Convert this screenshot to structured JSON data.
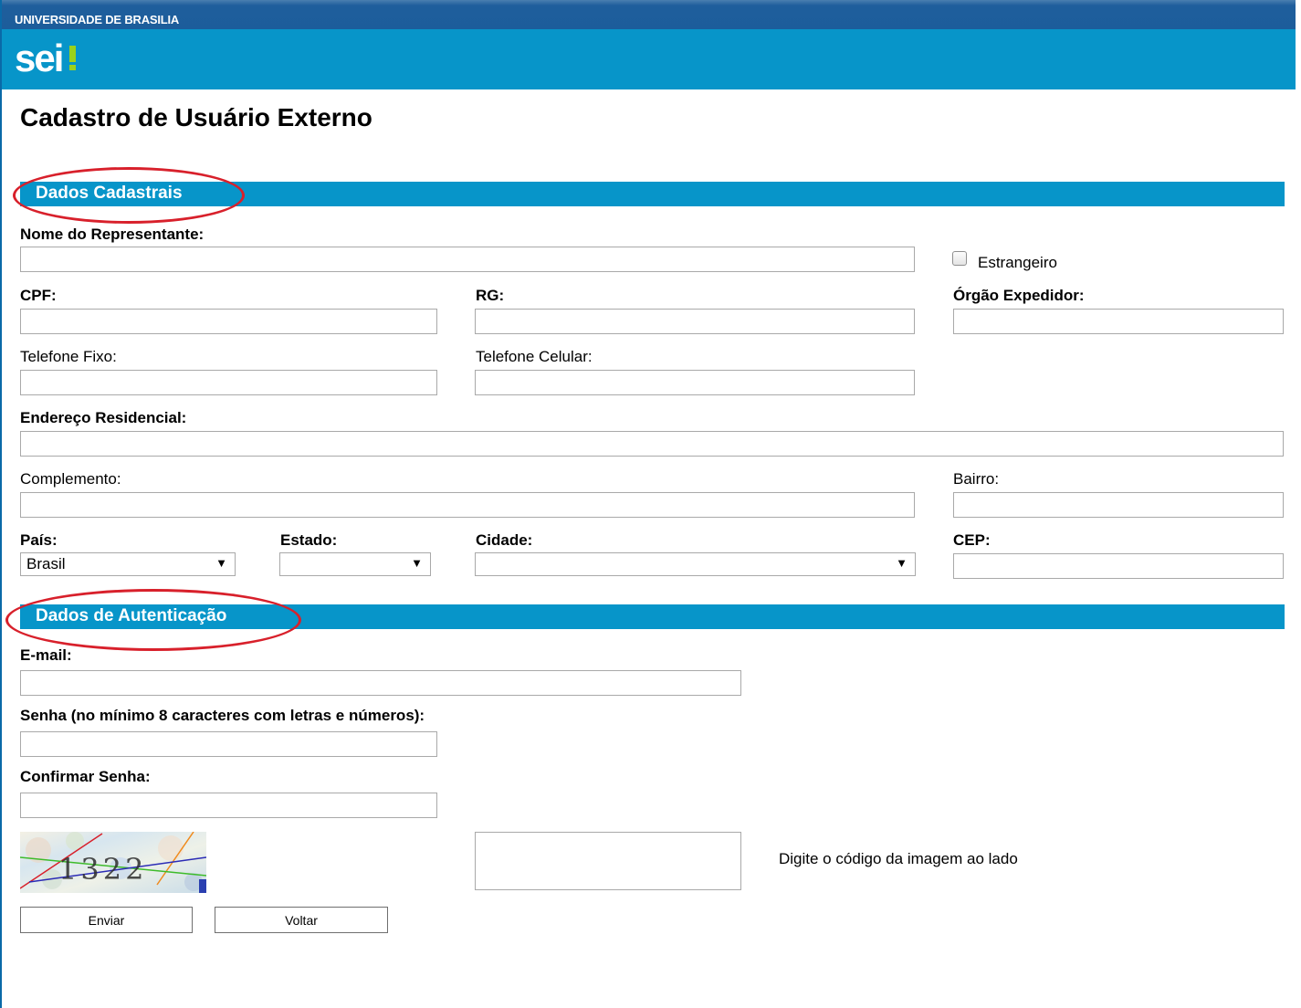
{
  "header": {
    "university": "UNIVERSIDADE DE BRASILIA",
    "logo_text": "sei",
    "logo_colors": {
      "text": "#ffffff",
      "accent": "#9ad21c"
    }
  },
  "page": {
    "title": "Cadastro de Usuário Externo"
  },
  "sections": {
    "dados_cadastrais": "Dados Cadastrais",
    "dados_autenticacao": "Dados de Autenticação"
  },
  "form": {
    "nome_label": "Nome do Representante:",
    "estrangeiro_label": "Estrangeiro",
    "estrangeiro_checked": false,
    "cpf_label": "CPF:",
    "rg_label": "RG:",
    "orgao_label": "Órgão Expedidor:",
    "telefone_fixo_label": "Telefone Fixo:",
    "telefone_celular_label": "Telefone Celular:",
    "endereco_label": "Endereço Residencial:",
    "complemento_label": "Complemento:",
    "bairro_label": "Bairro:",
    "pais_label": "País:",
    "pais_value": "Brasil",
    "estado_label": "Estado:",
    "estado_value": "",
    "cidade_label": "Cidade:",
    "cidade_value": "",
    "cep_label": "CEP:",
    "email_label": "E-mail:",
    "senha_label": "Senha (no mínimo 8 caracteres com letras e números):",
    "confirmar_label": "Confirmar Senha:",
    "captcha_code": "1322",
    "captcha_hint": "Digite o código da imagem ao lado"
  },
  "buttons": {
    "enviar": "Enviar",
    "voltar": "Voltar"
  },
  "colors": {
    "header_blue": "#0795c9",
    "topbar_blue": "#1c5d9b",
    "highlight_ellipse": "#d8202b"
  },
  "icons": {
    "dropdown": "dropdown-arrow-icon"
  }
}
